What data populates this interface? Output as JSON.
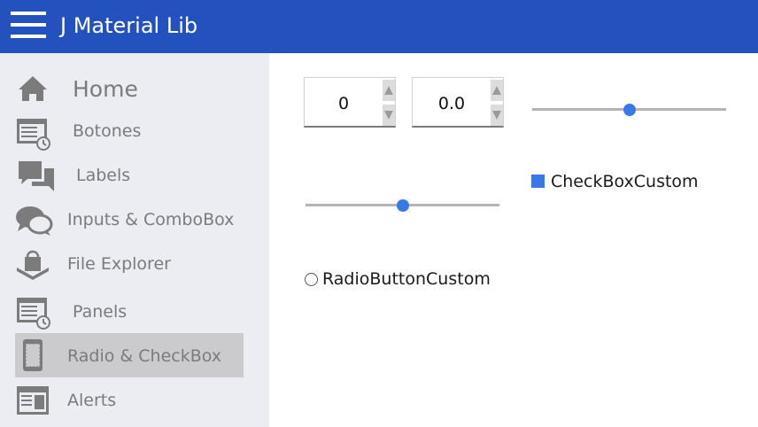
{
  "app": {
    "title": "J Material Lib",
    "header_color": "#2352bf",
    "menu_icon": "hamburger-menu-icon"
  },
  "sidebar": {
    "background": "#ececf3",
    "active_background": "#cbcbcd",
    "items": [
      {
        "label": "Home",
        "icon": "home-icon",
        "active": false
      },
      {
        "label": "Botones",
        "icon": "calendar-clock-icon",
        "active": false
      },
      {
        "label": "Labels",
        "icon": "chat-bubbles-icon",
        "active": false
      },
      {
        "label": "Inputs & ComboBox",
        "icon": "speech-bubbles-icon",
        "active": false
      },
      {
        "label": "File Explorer",
        "icon": "bag-download-icon",
        "active": false
      },
      {
        "label": "Panels",
        "icon": "calendar-clock-icon",
        "active": false
      },
      {
        "label": "Radio & CheckBox",
        "icon": "mobile-phone-icon",
        "active": true
      },
      {
        "label": "Alerts",
        "icon": "browser-window-icon",
        "active": false
      }
    ]
  },
  "main": {
    "spinner_int": {
      "value": "0"
    },
    "spinner_float": {
      "value": "0.0"
    },
    "slider_top": {
      "value": 0.5
    },
    "slider_bottom": {
      "value": 0.5
    },
    "checkbox": {
      "label": "CheckBoxCustom",
      "checked": true
    },
    "radio": {
      "label": "RadioButtonCustom",
      "selected": false
    },
    "accent_color": "#3b78e7"
  }
}
